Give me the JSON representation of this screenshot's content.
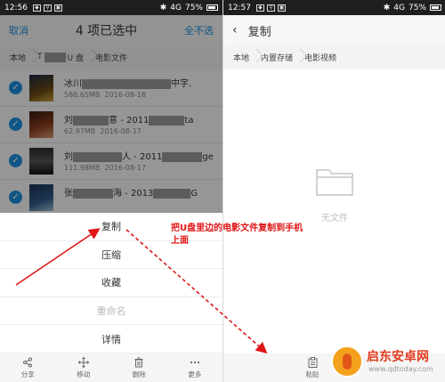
{
  "left_screen": {
    "status": {
      "time": "12:56",
      "signal": "4G",
      "battery": "75%"
    },
    "header": {
      "cancel": "取消",
      "title": "4 项已选中",
      "select_all": "全不选"
    },
    "breadcrumbs": [
      "本地",
      "T",
      "U 盘",
      "电影文件"
    ],
    "files": [
      {
        "name_start": "冰川",
        "name_end": "中字.",
        "size": "588.65MB",
        "date": "2016-08-18"
      },
      {
        "name_start": "刘",
        "name_end": "意 - 2011",
        "name_tail": "ta",
        "size": "62.97MB",
        "date": "2016-08-17"
      },
      {
        "name_start": "刘",
        "name_end": "人 - 2011",
        "name_tail": "ge",
        "size": "111.98MB",
        "date": "2016-08-17"
      },
      {
        "name_start": "张",
        "name_end": "海 - 2013",
        "name_tail": "G",
        "size": "",
        "date": ""
      }
    ],
    "menu": [
      {
        "label": "复制",
        "enabled": true
      },
      {
        "label": "压缩",
        "enabled": true
      },
      {
        "label": "收藏",
        "enabled": true
      },
      {
        "label": "重命名",
        "enabled": false
      },
      {
        "label": "详情",
        "enabled": true
      }
    ],
    "bottom_bar": [
      {
        "label": "分享",
        "icon": "share-icon"
      },
      {
        "label": "移动",
        "icon": "move-icon"
      },
      {
        "label": "删除",
        "icon": "delete-icon"
      },
      {
        "label": "更多",
        "icon": "more-icon"
      }
    ]
  },
  "right_screen": {
    "status": {
      "time": "12:57",
      "signal": "4G",
      "battery": "75%"
    },
    "header": {
      "back_icon": "back-arrow-icon",
      "title": "复制"
    },
    "breadcrumbs": [
      "本地",
      "内置存储",
      "电影视频"
    ],
    "empty_text": "无文件",
    "bottom_bar": {
      "paste_label": "粘贴",
      "icon": "clipboard-icon"
    }
  },
  "annotation": {
    "text": "把U盘里边的电影文件复制到手机上面",
    "color": "#e01515"
  },
  "watermark": {
    "title": "启东安卓网",
    "url": "www.qdtoday.com"
  },
  "colors": {
    "accent": "#1a8fe0",
    "annotation_red": "#e01515",
    "disabled_text": "#bbbbbb"
  }
}
